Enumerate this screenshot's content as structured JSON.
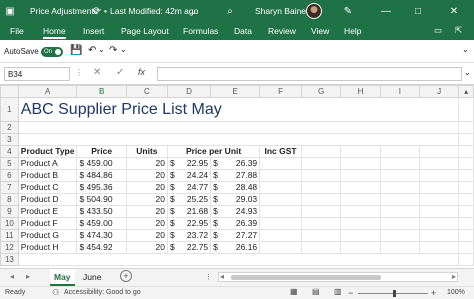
{
  "titlebar": {
    "doc_name": "Price Adjustments",
    "modified": "Last Modified: 42m ago",
    "user": "Sharyn Baines"
  },
  "menu": [
    "File",
    "Home",
    "Insert",
    "Page Layout",
    "Formulas",
    "Data",
    "Review",
    "View",
    "Help"
  ],
  "qat": {
    "autosave_label": "AutoSave",
    "toggle": "On"
  },
  "formula_bar": {
    "cell_ref": "B34",
    "fx": "fx",
    "value": ""
  },
  "columns": [
    "A",
    "B",
    "C",
    "D",
    "E",
    "F",
    "G",
    "H",
    "I",
    "J"
  ],
  "title_cell": "ABC Supplier Price List May",
  "headers": [
    "Product Type",
    "Price",
    "Units",
    "Price per Unit",
    "Inc GST"
  ],
  "rows": [
    [
      "Product A",
      "$ 459.00",
      "20",
      "$",
      "22.95",
      "$",
      "26.39"
    ],
    [
      "Product B",
      "$ 484.86",
      "20",
      "$",
      "24.24",
      "$",
      "27.88"
    ],
    [
      "Product C",
      "$ 495.36",
      "20",
      "$",
      "24.77",
      "$",
      "28.48"
    ],
    [
      "Product D",
      "$ 504.90",
      "20",
      "$",
      "25.25",
      "$",
      "29.03"
    ],
    [
      "Product E",
      "$ 433.50",
      "20",
      "$",
      "21.68",
      "$",
      "24.93"
    ],
    [
      "Product F",
      "$ 459.00",
      "20",
      "$",
      "22.95",
      "$",
      "26.39"
    ],
    [
      "Product G",
      "$ 474.30",
      "20",
      "$",
      "23.72",
      "$",
      "27.27"
    ],
    [
      "Product H",
      "$ 454.92",
      "20",
      "$",
      "22.75",
      "$",
      "26.16"
    ]
  ],
  "row_numbers": [
    "1",
    "2",
    "3",
    "4",
    "5",
    "6",
    "7",
    "8",
    "9",
    "10",
    "11",
    "12",
    "13"
  ],
  "sheets": [
    "May",
    "June"
  ],
  "status": {
    "ready": "Ready",
    "accessibility": "Accessibility: Good to go",
    "zoom": "100%"
  }
}
